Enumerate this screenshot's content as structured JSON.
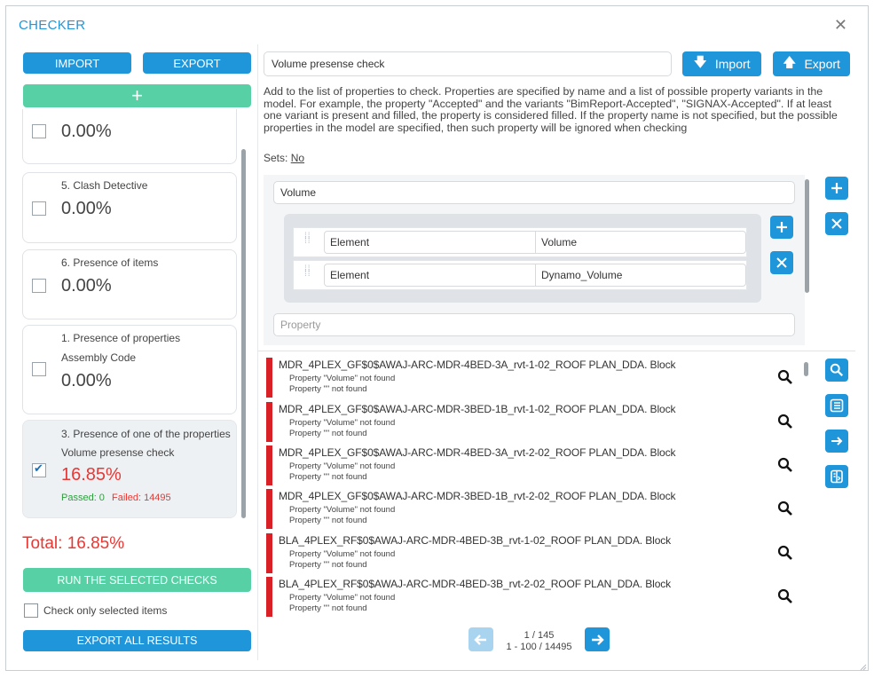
{
  "window": {
    "title": "CHECKER",
    "close_icon": "close-icon"
  },
  "left": {
    "import_label": "IMPORT",
    "export_label": "EXPORT",
    "add_label": "+",
    "cards": [
      {
        "name": "",
        "name2": "",
        "percent": "0.00%",
        "checked": false,
        "selected": false
      },
      {
        "name": "5. Clash Detective",
        "name2": "",
        "percent": "0.00%",
        "checked": false,
        "selected": false
      },
      {
        "name": "6. Presence of items",
        "name2": "",
        "percent": "0.00%",
        "checked": false,
        "selected": false
      },
      {
        "name": "1. Presence of properties",
        "name2": "Assembly Code",
        "percent": "0.00%",
        "checked": false,
        "selected": false
      },
      {
        "name": "3. Presence of one of the properties",
        "name2": "Volume presense check",
        "percent": "16.85%",
        "checked": true,
        "selected": true,
        "passed": "Passed: 0",
        "failed": "Failed: 14495"
      }
    ],
    "total": "Total: 16.85%",
    "run_label": "RUN THE SELECTED CHECKS",
    "check_only_label": "Check only selected items",
    "export_all_label": "EXPORT ALL RESULTS"
  },
  "right": {
    "check_name": "Volume presense check",
    "import_label": "Import",
    "export_label": "Export",
    "description": "Add to the list of properties to check. Properties are specified by name and a list of possible property variants in the model. For example, the property \"Accepted\" and the variants \"BimReport-Accepted\", \"SIGNAX-Accepted\". If at least one variant is present and filled, the property is considered filled. If the property name is not specified, but the possible properties in the model are specified, then such property will be ignored when checking",
    "sets_label": "Sets:",
    "sets_value": "No",
    "property_name": "Volume",
    "variants": [
      {
        "category": "Element",
        "property": "Volume"
      },
      {
        "category": "Element",
        "property": "Dynamo_Volume"
      }
    ],
    "property_placeholder": "Property",
    "results": [
      {
        "title": "MDR_4PLEX_GF$0$AWAJ-ARC-MDR-4BED-3A_rvt-1-02_ROOF PLAN_DDA. Block",
        "line1": "Property \"Volume\" not found",
        "line2": "Property \"\" not found"
      },
      {
        "title": "MDR_4PLEX_GF$0$AWAJ-ARC-MDR-3BED-1B_rvt-1-02_ROOF PLAN_DDA. Block",
        "line1": "Property \"Volume\" not found",
        "line2": "Property \"\" not found"
      },
      {
        "title": "MDR_4PLEX_GF$0$AWAJ-ARC-MDR-4BED-3A_rvt-2-02_ROOF PLAN_DDA. Block",
        "line1": "Property \"Volume\" not found",
        "line2": "Property \"\" not found"
      },
      {
        "title": "MDR_4PLEX_GF$0$AWAJ-ARC-MDR-3BED-1B_rvt-2-02_ROOF PLAN_DDA. Block",
        "line1": "Property \"Volume\" not found",
        "line2": "Property \"\" not found"
      },
      {
        "title": "BLA_4PLEX_RF$0$AWAJ-ARC-MDR-4BED-3B_rvt-1-02_ROOF PLAN_DDA. Block",
        "line1": "Property \"Volume\" not found",
        "line2": "Property \"\" not found"
      },
      {
        "title": "BLA_4PLEX_RF$0$AWAJ-ARC-MDR-4BED-3B_rvt-2-02_ROOF PLAN_DDA. Block",
        "line1": "Property \"Volume\" not found",
        "line2": "Property \"\" not found"
      }
    ],
    "pager": {
      "page": "1 / 145",
      "range": "1 - 100 / 14495"
    }
  },
  "colors": {
    "accent": "#1f95da",
    "green": "#56d0a4",
    "error": "#e53935",
    "pass": "#2e9e3e"
  }
}
